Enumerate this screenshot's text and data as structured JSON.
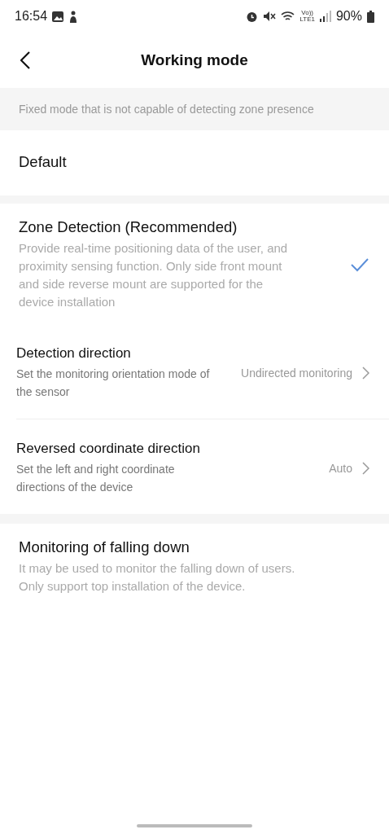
{
  "status_bar": {
    "time": "16:54",
    "volte": "Vo))",
    "network": "LTE1",
    "battery": "90%"
  },
  "header": {
    "title": "Working mode"
  },
  "banner": {
    "text": "Fixed mode that is not capable of detecting zone presence"
  },
  "modes": [
    {
      "title": "Default",
      "selected": false
    },
    {
      "title": "Zone Detection (Recommended)",
      "description": "Provide real-time positioning data of the user, and proximity sensing function. Only side front mount and side reverse mount are supported for the device installation",
      "selected": true,
      "settings": [
        {
          "title": "Detection direction",
          "description": "Set the monitoring orientation mode of the sensor",
          "value": "Undirected monitoring"
        },
        {
          "title": "Reversed coordinate direction",
          "description": "Set the left and right coordinate directions of the device",
          "value": "Auto"
        }
      ]
    },
    {
      "title": "Monitoring of falling down",
      "description": "It may be used to monitor the falling down of users. Only support top installation of the device.",
      "selected": false
    }
  ]
}
